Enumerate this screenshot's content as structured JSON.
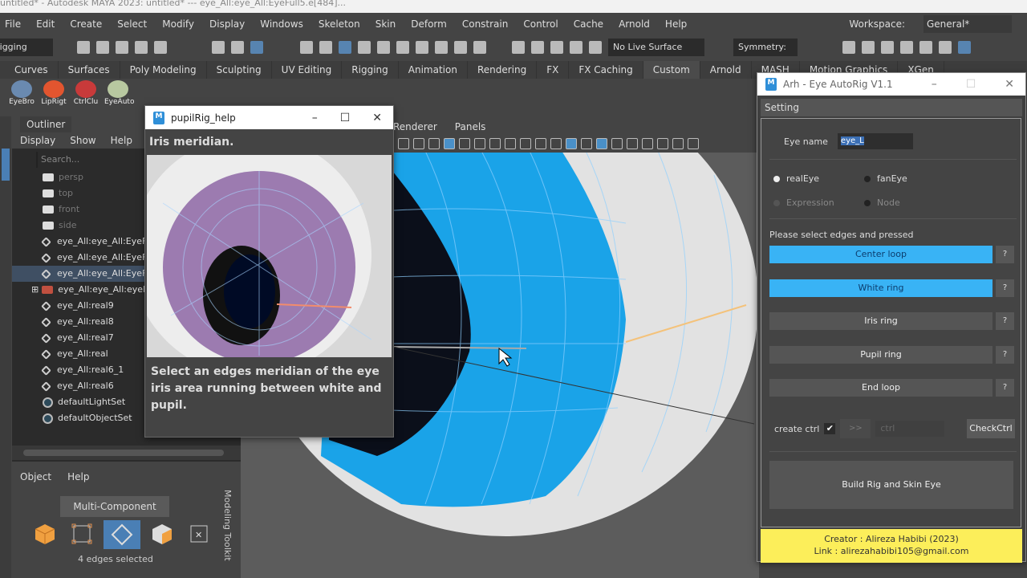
{
  "window_title": "untitled* - Autodesk MAYA 2023: untitled*  ---  eye_All:eye_All:EyeFull5.e[484]...",
  "menu": [
    "File",
    "Edit",
    "Create",
    "Select",
    "Modify",
    "Display",
    "Windows",
    "Skeleton",
    "Skin",
    "Deform",
    "Constrain",
    "Control",
    "Cache",
    "Arnold",
    "Help"
  ],
  "workspace": {
    "label": "Workspace:",
    "value": "General*"
  },
  "toolbar": {
    "mode": "Rigging",
    "live_surface": "No Live Surface",
    "symmetry": "Symmetry: Off"
  },
  "shelf_tabs": [
    "Curves",
    "Surfaces",
    "Poly Modeling",
    "Sculpting",
    "UV Editing",
    "Rigging",
    "Animation",
    "Rendering",
    "FX",
    "FX Caching",
    "Custom",
    "Arnold",
    "MASH",
    "Motion Graphics",
    "XGen"
  ],
  "shelf_items": [
    {
      "label": "EyeBro",
      "color": "#6a8ab0"
    },
    {
      "label": "LipRigt",
      "color": "#e2552f"
    },
    {
      "label": "CtrlClu",
      "color": "#c83a3a"
    },
    {
      "label": "EyeAuto",
      "color": "#b8c8a0"
    }
  ],
  "outliner": {
    "title": "Outliner",
    "menu": [
      "Display",
      "Show",
      "Help"
    ],
    "search_placeholder": "Search...",
    "items": [
      {
        "label": "persp",
        "type": "cam"
      },
      {
        "label": "top",
        "type": "cam"
      },
      {
        "label": "front",
        "type": "cam"
      },
      {
        "label": "side",
        "type": "cam"
      },
      {
        "label": "eye_All:eye_All:EyeFu",
        "type": "tr"
      },
      {
        "label": "eye_All:eye_All:EyeFu",
        "type": "tr"
      },
      {
        "label": "eye_All:eye_All:EyeFu",
        "type": "tr",
        "selected": true
      },
      {
        "label": "eye_All:eye_All:eyeFu",
        "type": "grp"
      },
      {
        "label": "eye_All:real9",
        "type": "tr"
      },
      {
        "label": "eye_All:real8",
        "type": "tr"
      },
      {
        "label": "eye_All:real7",
        "type": "tr"
      },
      {
        "label": "eye_All:real",
        "type": "tr"
      },
      {
        "label": "eye_All:real6_1",
        "type": "tr"
      },
      {
        "label": "eye_All:real6",
        "type": "tr"
      },
      {
        "label": "defaultLightSet",
        "type": "set"
      },
      {
        "label": "defaultObjectSet",
        "type": "set"
      }
    ]
  },
  "modeling_toolkit": {
    "menu": [
      "Object",
      "Help"
    ],
    "mode": "Multi-Component",
    "status": "4 edges selected",
    "tab": "Modeling Toolkit"
  },
  "viewport": {
    "menu": [
      "Renderer",
      "Panels"
    ]
  },
  "help_window": {
    "title": "pupilRig_help",
    "heading": "Iris meridian.",
    "text": "Select an edges meridian of the eye iris area running between white and pupil."
  },
  "autorig": {
    "title": "Arh - Eye AutoRig V1.1",
    "section": "Setting",
    "eye_name_label": "Eye name",
    "eye_name_value": "eye_L",
    "radios": [
      {
        "label": "realEye",
        "checked": true,
        "enabled": true
      },
      {
        "label": "fanEye",
        "checked": false,
        "enabled": true
      },
      {
        "label": "Expression",
        "checked": false,
        "enabled": false
      },
      {
        "label": "Node",
        "checked": false,
        "enabled": false
      }
    ],
    "instruction": "Please select edges and pressed",
    "buttons": [
      {
        "label": "Center loop",
        "active": true
      },
      {
        "label": "White ring",
        "active": true
      },
      {
        "label": "Iris ring",
        "active": false
      },
      {
        "label": "Pupil ring",
        "active": false
      },
      {
        "label": "End loop",
        "active": false
      }
    ],
    "help_label": "?",
    "create_ctrl_label": "create ctrl",
    "create_ctrl_checked": true,
    "arrow_label": ">>",
    "ctrl_placeholder": "ctrl",
    "check_ctrl": "CheckCtrl",
    "build": "Build Rig and Skin Eye",
    "creator": "Creator : Alireza Habibi (2023)",
    "link": "Link : alirezahabibi105@gmail.com"
  }
}
